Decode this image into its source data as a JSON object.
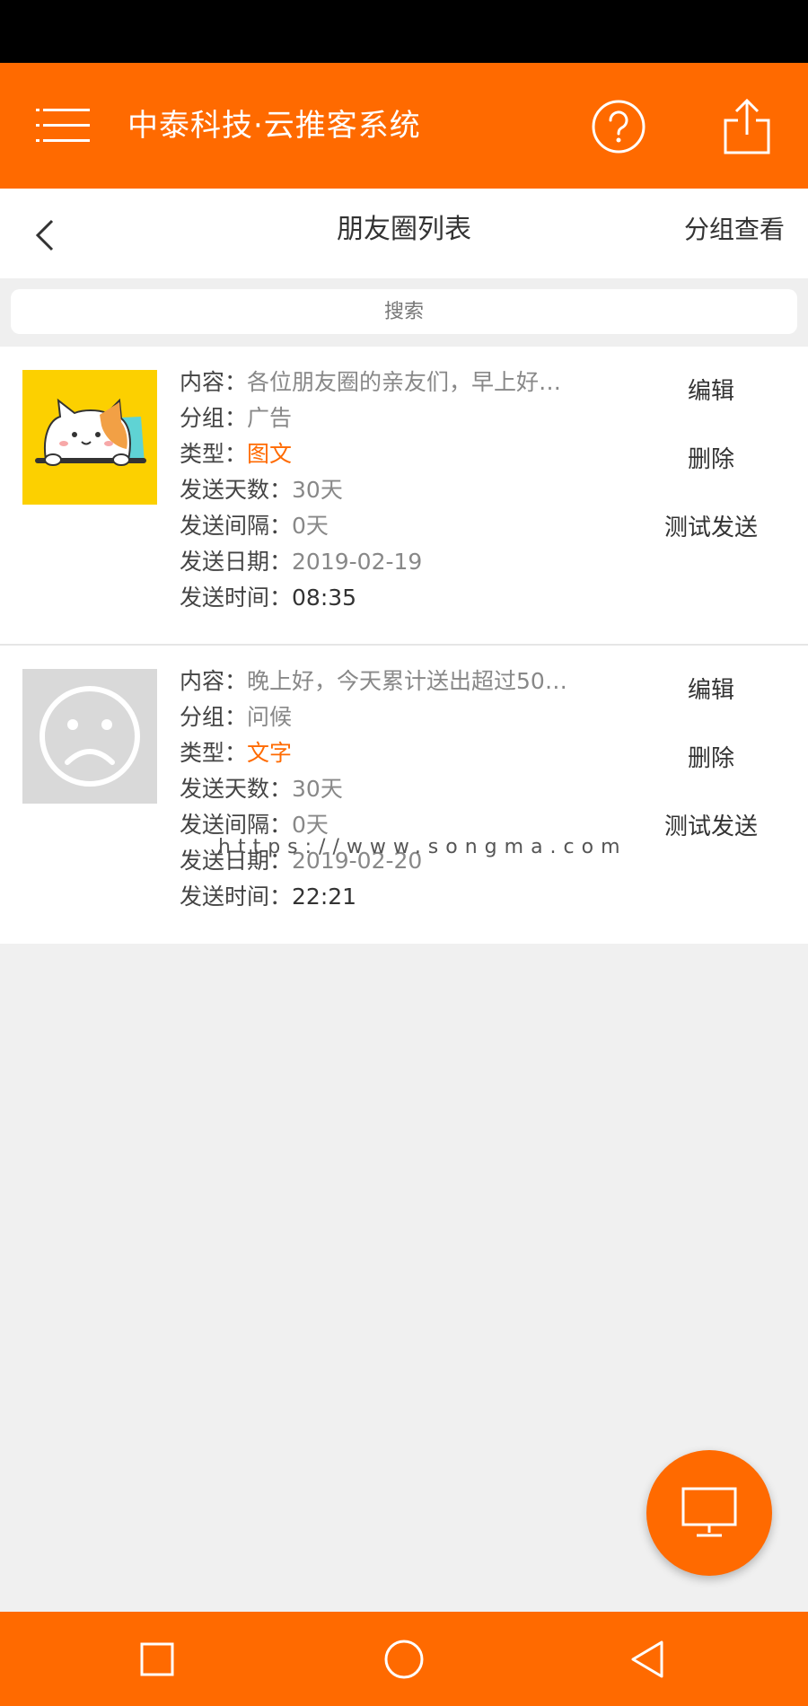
{
  "app": {
    "title": "中泰科技·云推客系统"
  },
  "nav": {
    "title": "朋友圈列表",
    "group_view": "分组查看"
  },
  "search": {
    "placeholder": "搜索"
  },
  "labels": {
    "content": "内容：",
    "group": "分组：",
    "type": "类型：",
    "send_days": "发送天数：",
    "send_interval": "发送间隔：",
    "send_date": "发送日期：",
    "send_time": "发送时间："
  },
  "actions": {
    "edit": "编辑",
    "delete": "删除",
    "test_send": "测试发送"
  },
  "posts": [
    {
      "content": "各位朋友圈的亲友们，早上好…",
      "group": "广告",
      "type": "图文",
      "send_days": "30天",
      "send_interval": "0天",
      "send_date": "2019-02-19",
      "send_time": "08:35",
      "thumbnail": "cat-icon"
    },
    {
      "content": "晚上好，今天累计送出超过50…",
      "group": "问候",
      "type": "文字",
      "send_days": "30天",
      "send_interval": "0天",
      "send_date": "2019-02-20",
      "send_time": "22:21",
      "thumbnail": "sad-face-icon"
    }
  ],
  "watermark": "https://www.songma.com",
  "colors": {
    "brand": "#ff6a00",
    "status_bar": "#000000",
    "background": "#f0f0f0"
  }
}
